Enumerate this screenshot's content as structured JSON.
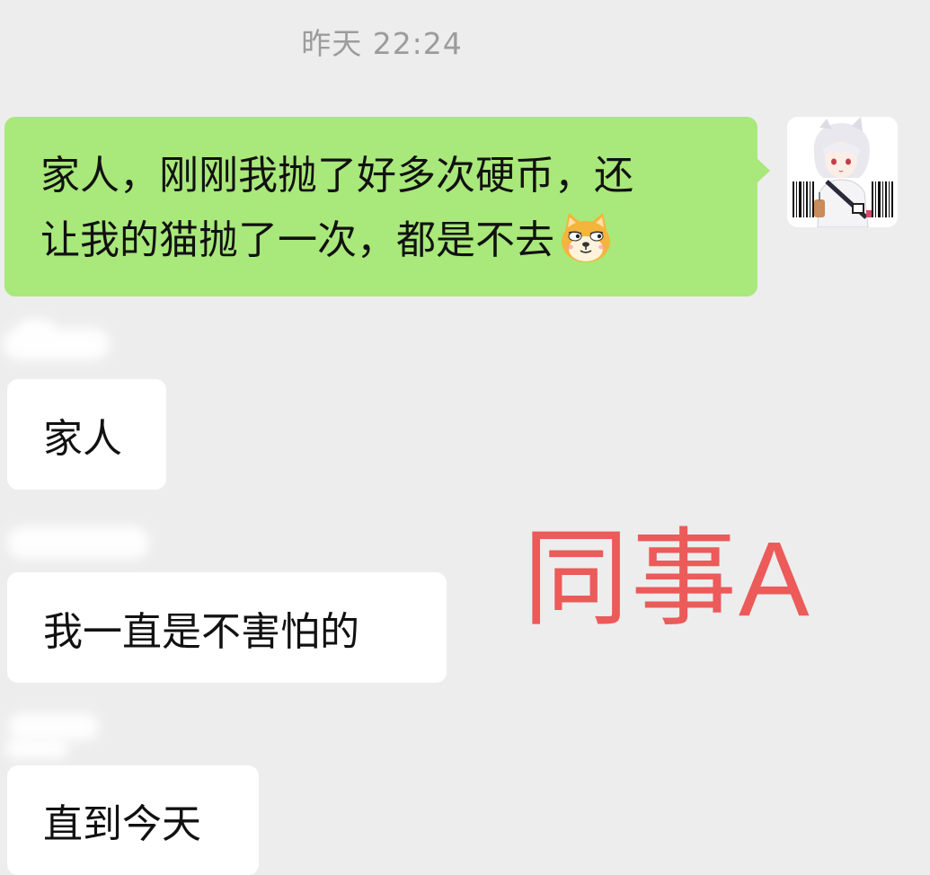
{
  "chat": {
    "timestamp": "昨天 22:24",
    "outgoing": {
      "line1": "家人，刚刚我抛了好多次硬币，还",
      "line2": "让我的猫抛了一次，都是不去",
      "emoji": "doge-cat-emoji"
    },
    "incoming": [
      {
        "text": "家人"
      },
      {
        "text": "我一直是不害怕的"
      },
      {
        "text": "直到今天"
      }
    ],
    "avatar_icon": "anime-character-avatar"
  },
  "overlay": {
    "label": "同事A"
  },
  "colors": {
    "background": "#ededed",
    "outgoing_bubble": "#a9e87a",
    "incoming_bubble": "#ffffff",
    "timestamp": "#9c9c9c",
    "overlay_text": "#ec5a5a"
  }
}
